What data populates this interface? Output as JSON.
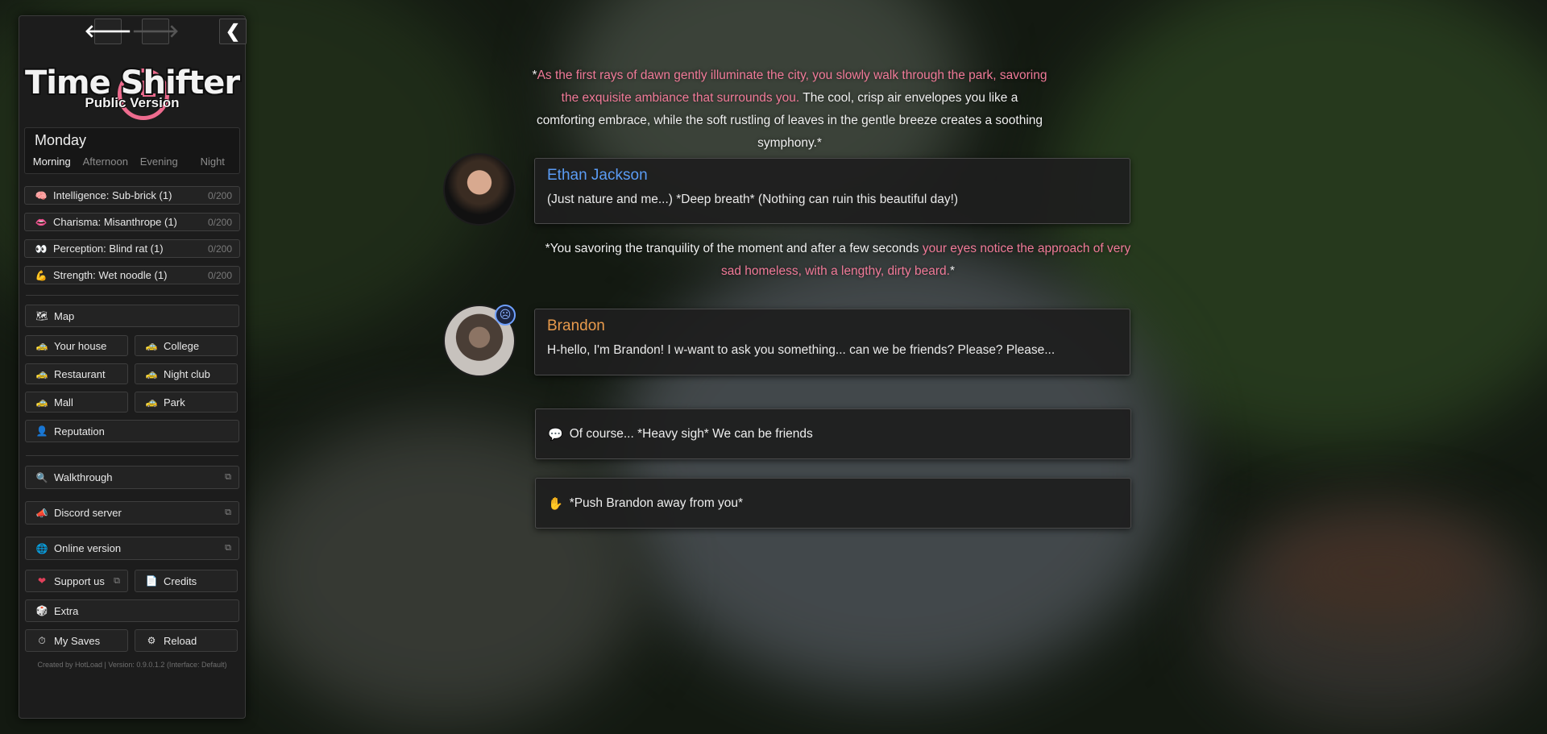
{
  "nav": {
    "back_glyph": "🡐",
    "forward_glyph": "🡒",
    "collapse_glyph": "❮"
  },
  "logo": {
    "title": "Time Shifter",
    "subtitle": "Public Version"
  },
  "calendar": {
    "day": "Monday",
    "times": [
      "Morning",
      "Afternoon",
      "Evening",
      "Night"
    ],
    "active_time": "Morning"
  },
  "stats": [
    {
      "icon": "🧠",
      "label": "Intelligence: Sub-brick (1)",
      "value": "0/200"
    },
    {
      "icon": "👄",
      "label": "Charisma: Misanthrope (1)",
      "value": "0/200"
    },
    {
      "icon": "👀",
      "label": "Perception: Blind rat (1)",
      "value": "0/200"
    },
    {
      "icon": "💪",
      "label": "Strength: Wet noodle (1)",
      "value": "0/200"
    }
  ],
  "map": {
    "icon": "🗺",
    "label": "Map"
  },
  "locations": [
    {
      "icon": "🚕",
      "label": "Your house"
    },
    {
      "icon": "🚕",
      "label": "College"
    },
    {
      "icon": "🚕",
      "label": "Restaurant"
    },
    {
      "icon": "🚕",
      "label": "Night club"
    },
    {
      "icon": "🚕",
      "label": "Mall"
    },
    {
      "icon": "🚕",
      "label": "Park"
    }
  ],
  "reputation": {
    "icon": "👤",
    "label": "Reputation"
  },
  "links": [
    {
      "icon": "🔍",
      "label": "Walkthrough",
      "ext": "⧉"
    },
    {
      "icon": "📣",
      "label": "Discord server",
      "ext": "⧉"
    },
    {
      "icon": "🌐",
      "label": "Online version",
      "ext": "⧉"
    }
  ],
  "support": {
    "icon": "❤",
    "label": "Support us",
    "ext": "⧉"
  },
  "credits": {
    "icon": "📄",
    "label": "Credits"
  },
  "extra": {
    "icon": "🎲",
    "label": "Extra"
  },
  "saves": {
    "icon": "⏱",
    "label": "My Saves"
  },
  "reload": {
    "icon": "⚙",
    "label": "Reload"
  },
  "footer": "Created by HotLoad | Version: 0.9.0.1.2 (Interface: Default)",
  "story": {
    "narration1": {
      "pre": "*",
      "pink": "As the first rays of dawn gently illuminate the city, you slowly walk through the park, savoring the exquisite ambiance that surrounds you.",
      "post": " The cool, crisp air envelopes you like a comforting embrace, while the soft rustling of leaves in the gentle breeze creates a soothing symphony.*"
    },
    "dialog1": {
      "speaker": "Ethan Jackson",
      "speaker_color": "#5b9cf5",
      "line": "(Just nature and me...) *Deep breath* (Nothing can ruin this beautiful day!)"
    },
    "narration2": {
      "pre": "*You savoring the tranquility of the moment and after a few seconds ",
      "pink": "your eyes notice the approach of very sad homeless, with a lengthy, dirty beard.",
      "post": "*"
    },
    "dialog2": {
      "speaker": "Brandon",
      "speaker_color": "#e89a4c",
      "mood_icon": "☹",
      "line": "H-hello, I'm Brandon! I w-want to ask you something... can we be friends? Please? Please..."
    },
    "choices": [
      {
        "icon": "💬",
        "label": "Of course... *Heavy sigh* We can be friends"
      },
      {
        "icon": "✋",
        "label": "*Push Brandon away from you*"
      }
    ]
  },
  "colors": {
    "accent_pink": "#f07a98",
    "ethan_blue": "#5b9cf5",
    "brandon_orange": "#e89a4c"
  }
}
